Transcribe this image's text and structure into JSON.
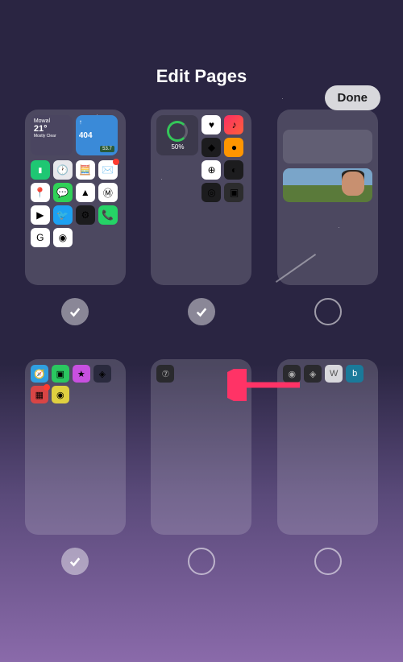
{
  "buttons": {
    "done": "Done"
  },
  "title": "Edit Pages",
  "pages": [
    {
      "id": 1,
      "selected": true
    },
    {
      "id": 2,
      "selected": true
    },
    {
      "id": 3,
      "selected": false
    },
    {
      "id": 4,
      "selected": true
    },
    {
      "id": 5,
      "selected": false
    },
    {
      "id": 6,
      "selected": false
    }
  ],
  "page1": {
    "weather": {
      "location": "Mowal",
      "temp": "21°",
      "condition": "Mostly Clear"
    },
    "stock": {
      "ticker": "↑",
      "price": "404",
      "change": "53.7"
    }
  },
  "page2": {
    "battery": "50%"
  },
  "arrow": {
    "color": "#ff3366"
  }
}
